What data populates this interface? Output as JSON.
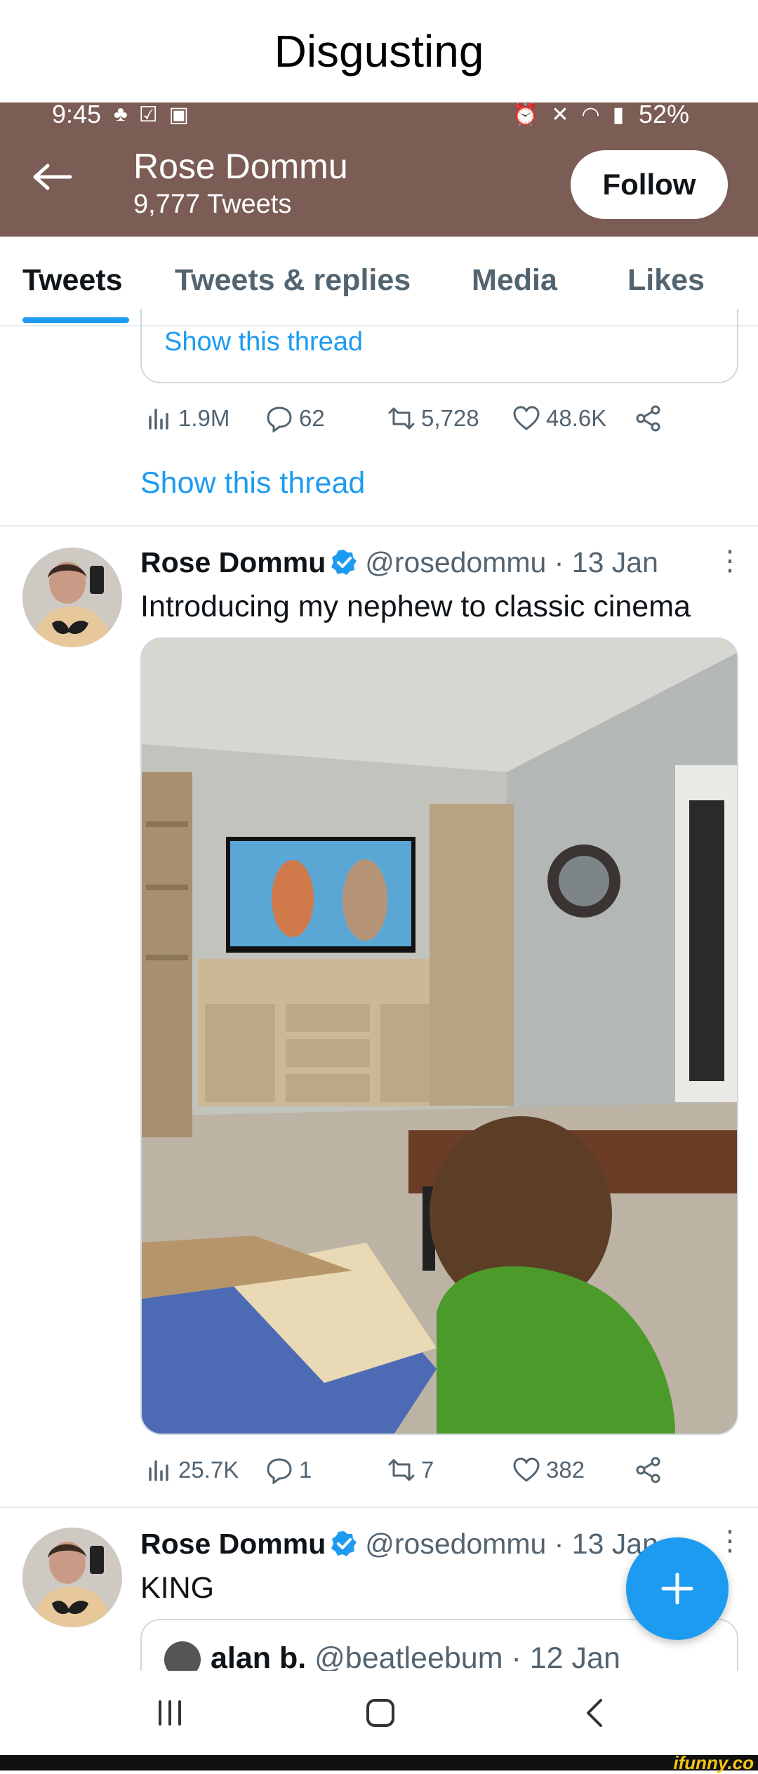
{
  "caption": "Disgusting",
  "status_bar": {
    "time": "9:45",
    "battery": "52%",
    "left_icons": [
      "person-icon",
      "check-box-icon",
      "image-icon"
    ],
    "right_icons": [
      "alarm-icon",
      "mute-icon",
      "wifi-icon",
      "signal-icon"
    ]
  },
  "profile": {
    "name": "Rose Dommu",
    "tweet_count": "9,777 Tweets",
    "follow_label": "Follow"
  },
  "tabs": [
    {
      "label": "Tweets",
      "active": true
    },
    {
      "label": "Tweets & replies",
      "active": false
    },
    {
      "label": "Media",
      "active": false
    },
    {
      "label": "Likes",
      "active": false
    }
  ],
  "previous_tweet": {
    "quoted_thread_link": "Show this thread",
    "views": "1.9M",
    "replies": "62",
    "retweets": "5,728",
    "likes": "48.6K",
    "show_thread": "Show this thread"
  },
  "tweet": {
    "name": "Rose Dommu",
    "handle": "@rosedommu",
    "date": "· 13 Jan",
    "text": "Introducing my nephew to classic cinema",
    "views": "25.7K",
    "replies": "1",
    "retweets": "7",
    "likes": "382"
  },
  "next_tweet": {
    "name": "Rose Dommu",
    "handle": "@rosedommu",
    "date": "· 13 Jan",
    "text": "KING",
    "quoted": {
      "name": "alan b.",
      "handle": "@beatleebum",
      "date": "· 12 Jan"
    }
  },
  "colors": {
    "header_bg": "#7b5d55",
    "accent": "#1d9bf0",
    "muted": "#536471"
  },
  "watermark": "ifunny.co"
}
